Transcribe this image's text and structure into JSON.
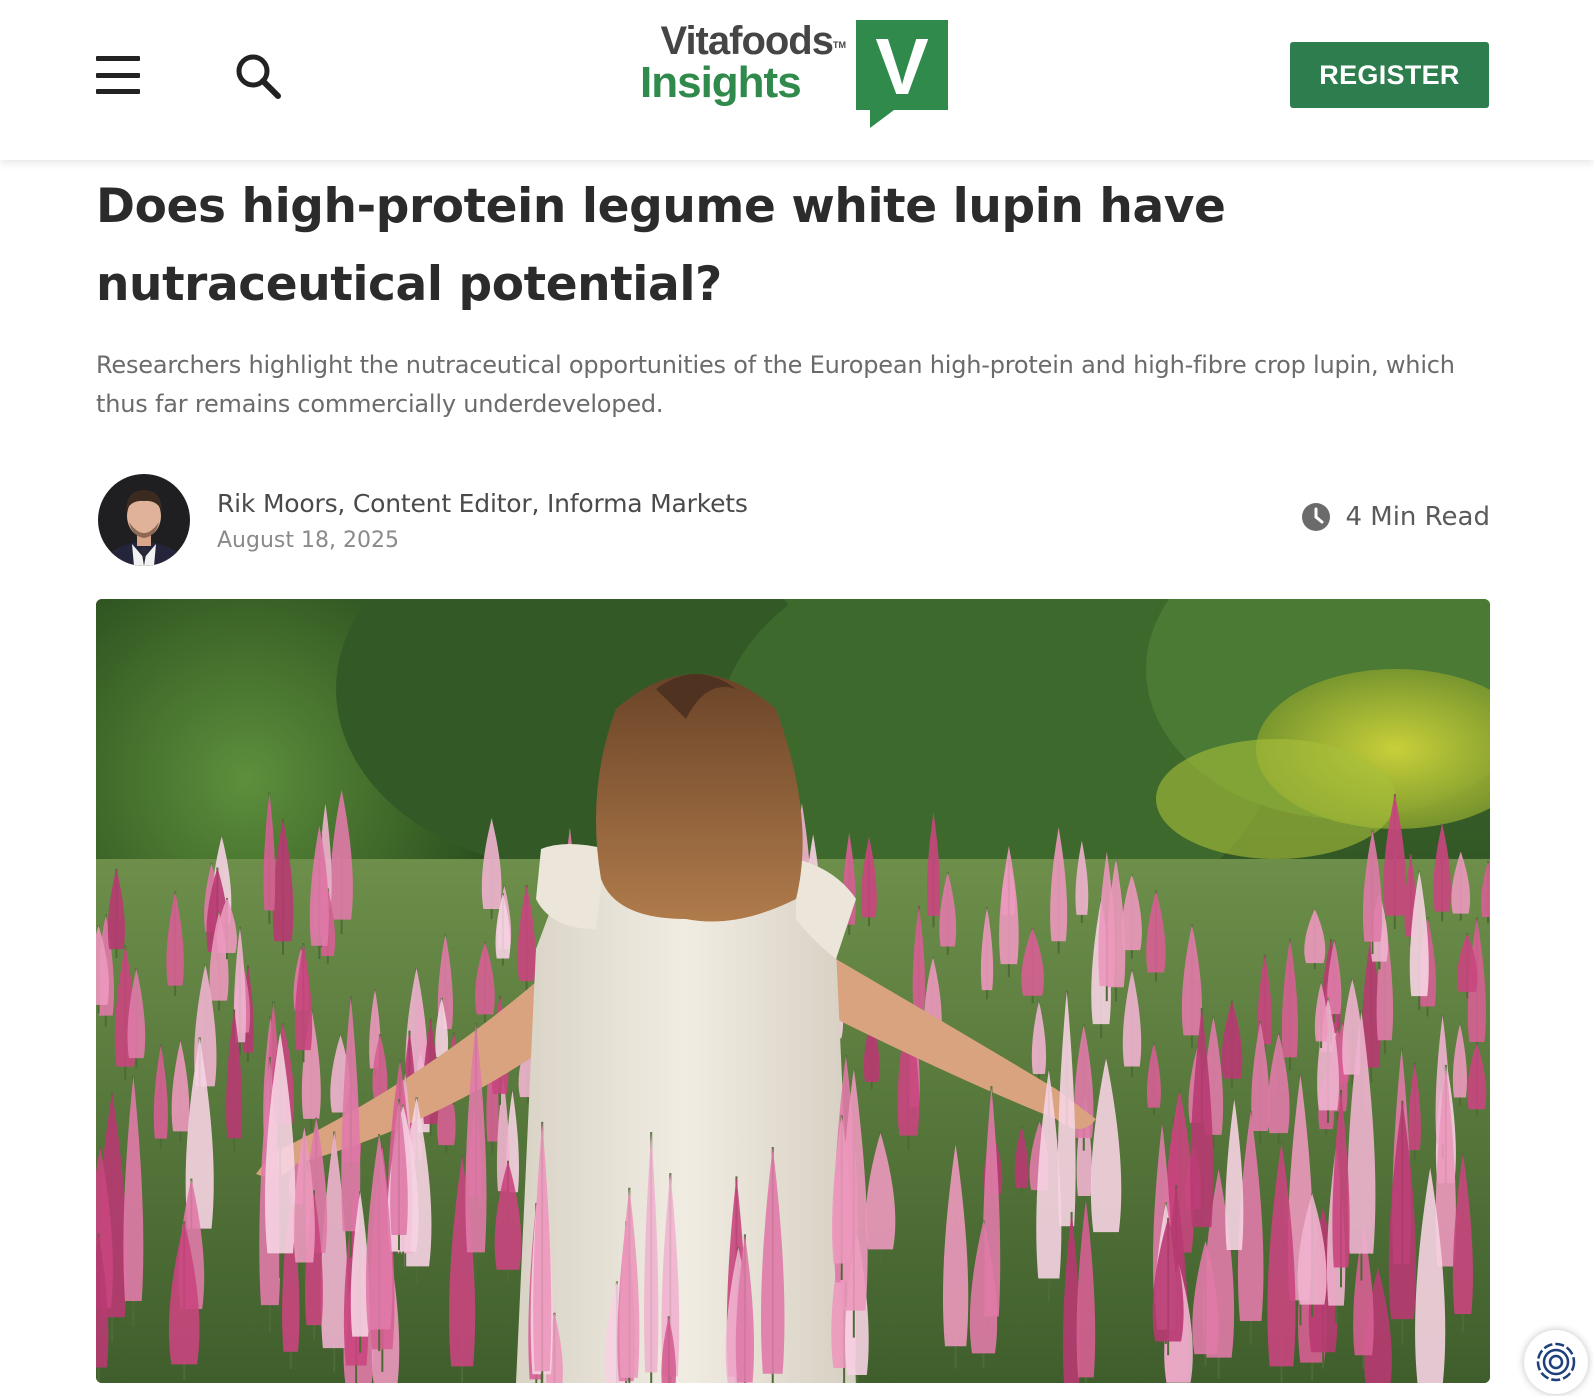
{
  "header": {
    "menu_icon": "hamburger-icon",
    "search_icon": "search-icon",
    "logo": {
      "line1": "Vitafoods",
      "trademark": "TM",
      "line2": "Insights",
      "badge_letter": "V",
      "brand_color": "#2f8a4c"
    },
    "register_label": "REGISTER",
    "register_color": "#2e7d4f"
  },
  "article": {
    "headline": "Does high-protein legume white lupin have nutraceutical potential?",
    "summary": "Researchers highlight the nutraceutical opportunities of the European high-protein and high-fibre crop lupin, which thus far remains commercially underdeveloped.",
    "author": {
      "name": "Rik Moors",
      "role": ", Content Editor, Informa Markets",
      "date": "August 18, 2025"
    },
    "read_time": "4 Min Read",
    "read_time_icon": "clock-icon",
    "hero_image": "woman-in-lupin-field-photo"
  },
  "privacy_button_icon": "privacy-settings-icon"
}
